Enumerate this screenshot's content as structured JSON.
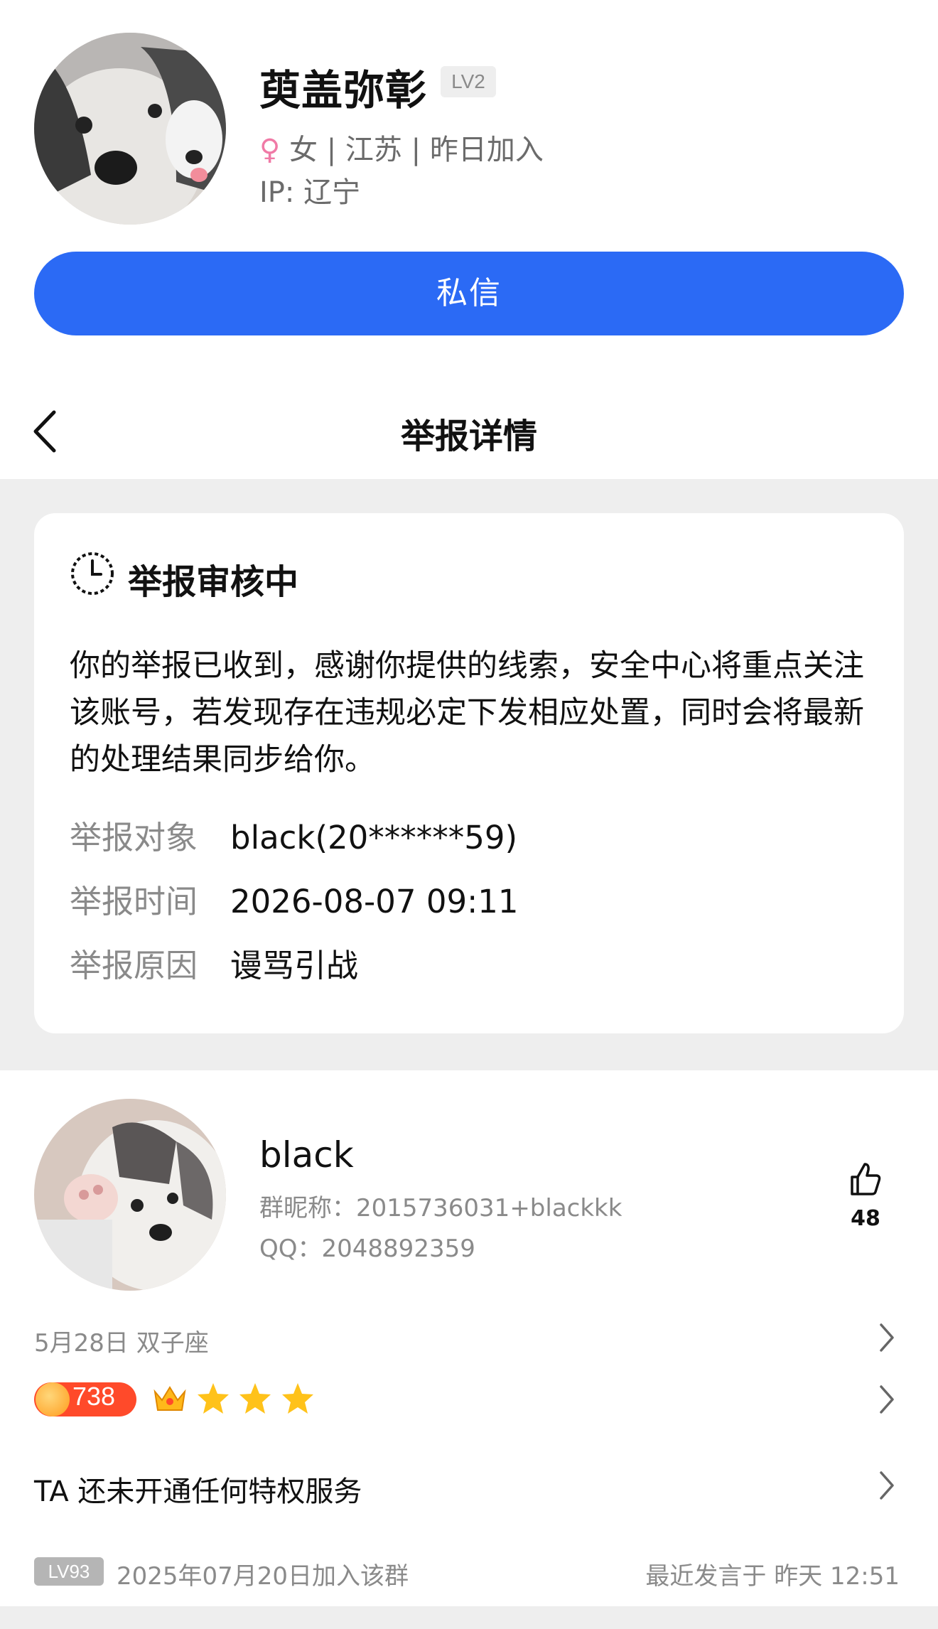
{
  "profile": {
    "name": "萸盖弥彰",
    "level_badge": "LV2",
    "gender_symbol": "♀",
    "meta": "女 | 江苏 | 昨日加入",
    "ip": "IP: 辽宁",
    "message_button": "私信"
  },
  "nav": {
    "title": "举报详情"
  },
  "report": {
    "status": "举报审核中",
    "notice": "你的举报已收到，感谢你提供的线索，安全中心将重点关注该账号，若发现存在违规必定下发相应处置，同时会将最新的处理结果同步给你。",
    "rows": [
      {
        "label": "举报对象",
        "value": "black(20******59)"
      },
      {
        "label": "举报时间",
        "value": "2026-08-07 09:11"
      },
      {
        "label": "举报原因",
        "value": "谩骂引战"
      }
    ]
  },
  "member": {
    "name": "black",
    "group_nickname": "群昵称：2015736031+blackkk",
    "qq": "QQ：2048892359",
    "like_count": "48",
    "birthday": "5月28日 双子座",
    "level_number": "738",
    "privilege_text": "TA 还未开通任何特权服务",
    "group_level_badge": "LV93",
    "join_date": "2025年07月20日加入该群",
    "last_speak": "最近发言于 昨天 12:51"
  },
  "colors": {
    "accent": "#2b6af5",
    "female": "#f07aa6",
    "gray_text": "#8a8a8a",
    "level_red": "#ff4a2a",
    "star": "#ffc21a"
  },
  "icons": {
    "back": "chevron-left-icon",
    "status": "clock-icon",
    "like": "thumbs-up-icon",
    "row_arrow": "chevron-right-icon",
    "crown": "crown-icon",
    "star": "star-icon"
  }
}
